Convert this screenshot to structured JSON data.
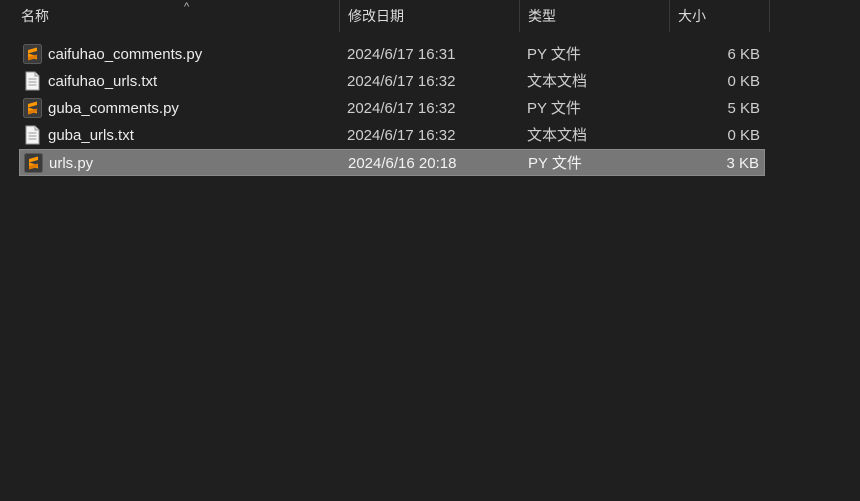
{
  "columns": {
    "name": "名称",
    "modified": "修改日期",
    "type": "类型",
    "size": "大小"
  },
  "sort_indicator": "^",
  "files": [
    {
      "name": "caifuhao_comments.py",
      "modified": "2024/6/17 16:31",
      "type": "PY 文件",
      "size": "6 KB",
      "icon": "sublime-python-file-icon",
      "selected": false
    },
    {
      "name": "caifuhao_urls.txt",
      "modified": "2024/6/17 16:32",
      "type": "文本文档",
      "size": "0 KB",
      "icon": "text-document-icon",
      "selected": false
    },
    {
      "name": "guba_comments.py",
      "modified": "2024/6/17 16:32",
      "type": "PY 文件",
      "size": "5 KB",
      "icon": "sublime-python-file-icon",
      "selected": false
    },
    {
      "name": "guba_urls.txt",
      "modified": "2024/6/17 16:32",
      "type": "文本文档",
      "size": "0 KB",
      "icon": "text-document-icon",
      "selected": false
    },
    {
      "name": "urls.py",
      "modified": "2024/6/16 20:18",
      "type": "PY 文件",
      "size": "3 KB",
      "icon": "sublime-python-file-icon",
      "selected": true
    }
  ],
  "colors": {
    "background": "#1f1f1f",
    "selection": "#777777",
    "sublime_orange": "#ff9800"
  }
}
